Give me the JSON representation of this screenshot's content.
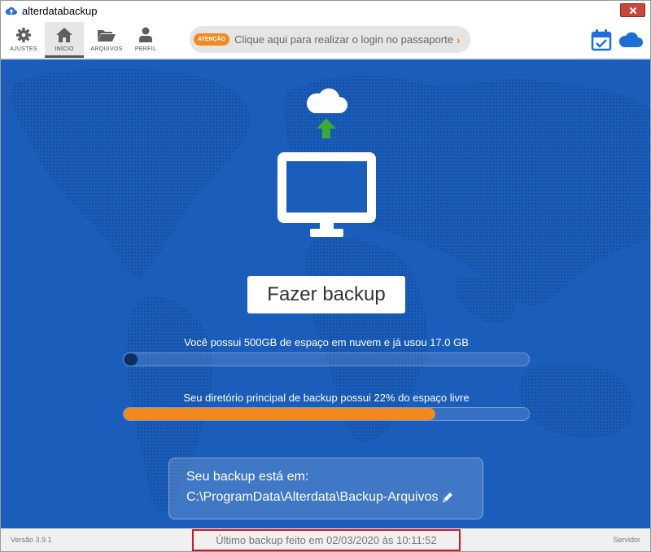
{
  "window": {
    "title": "alterdatabackup"
  },
  "toolbar": {
    "nav": [
      {
        "label": "AJUSTES",
        "icon": "gear-icon"
      },
      {
        "label": "INÍCIO",
        "icon": "home-icon"
      },
      {
        "label": "ARQUIVOS",
        "icon": "folder-icon"
      },
      {
        "label": "PERFIL",
        "icon": "user-icon"
      }
    ],
    "notice": {
      "badge": "ATENÇÃO",
      "text": "Clique aqui para realizar o login no passaporte",
      "chevron": "›"
    }
  },
  "main": {
    "backup_button": "Fazer backup",
    "cloud_usage": {
      "text": "Você possui 500GB de espaço em nuvem e já usou 17.0 GB",
      "used_fraction": 0.034
    },
    "disk_usage": {
      "text": "Seu diretório principal de backup possui 22% do espaço livre",
      "fill_fraction": 0.77
    },
    "path": {
      "title": "Seu backup está em:",
      "value": "C:\\ProgramData\\Alterdata\\Backup-Arquivos"
    }
  },
  "footer": {
    "version": "Versão 3.9.1",
    "last_backup": "Último backup feito em 02/03/2020 às 10:11:52",
    "server": "Servidor"
  },
  "colors": {
    "brand_blue": "#1b5dba",
    "accent_orange": "#f08a1e",
    "cloud_bar": "#0d2e60",
    "arrow_green": "#3aa935",
    "highlight_red": "#d0191e"
  }
}
